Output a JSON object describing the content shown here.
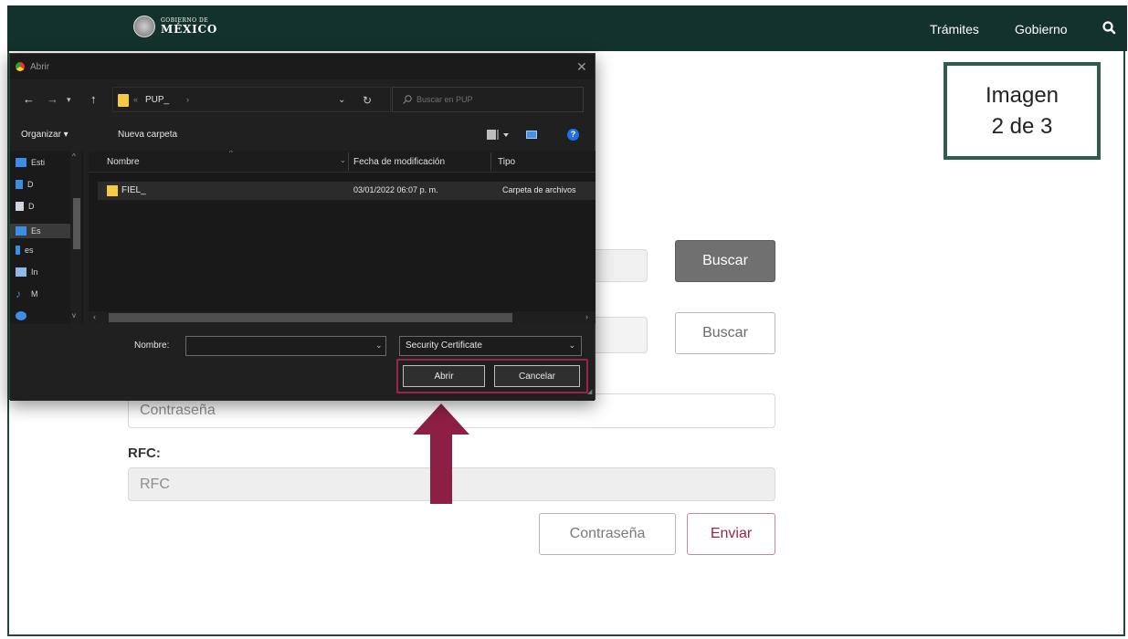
{
  "header": {
    "logo_small": "GOBIERNO DE",
    "logo_big": "MÉXICO",
    "nav": [
      "Trámites",
      "Gobierno"
    ]
  },
  "overlay": {
    "line1": "Imagen",
    "line2": "2 de 3"
  },
  "form": {
    "buscar_label": "Buscar",
    "password_placeholder": "Contraseña",
    "rfc_label": "RFC:",
    "rfc_placeholder": "RFC",
    "contrasena_button": "Contraseña",
    "enviar_button": "Enviar"
  },
  "dialog": {
    "title": "Abrir",
    "path": "PUP_",
    "search_placeholder": "Buscar en PUP",
    "toolbar": {
      "organizar": "Organizar ▾",
      "nueva_carpeta": "Nueva carpeta"
    },
    "nav_items": [
      "Esti",
      "D",
      "D",
      "Es",
      "es",
      "In",
      "M"
    ],
    "columns": [
      "Nombre",
      "Fecha de modificación",
      "Tipo"
    ],
    "files": [
      {
        "name": "FIEL_",
        "date": "03/01/2022 06:07 p. m.",
        "type": "Carpeta de archivos"
      }
    ],
    "nombre_label": "Nombre:",
    "filetype": "Security Certificate",
    "abrir": "Abrir",
    "cancelar": "Cancelar"
  },
  "colors": {
    "header_bg": "#13322b",
    "accent": "#9d2449",
    "frame": "#2f5d4b"
  }
}
